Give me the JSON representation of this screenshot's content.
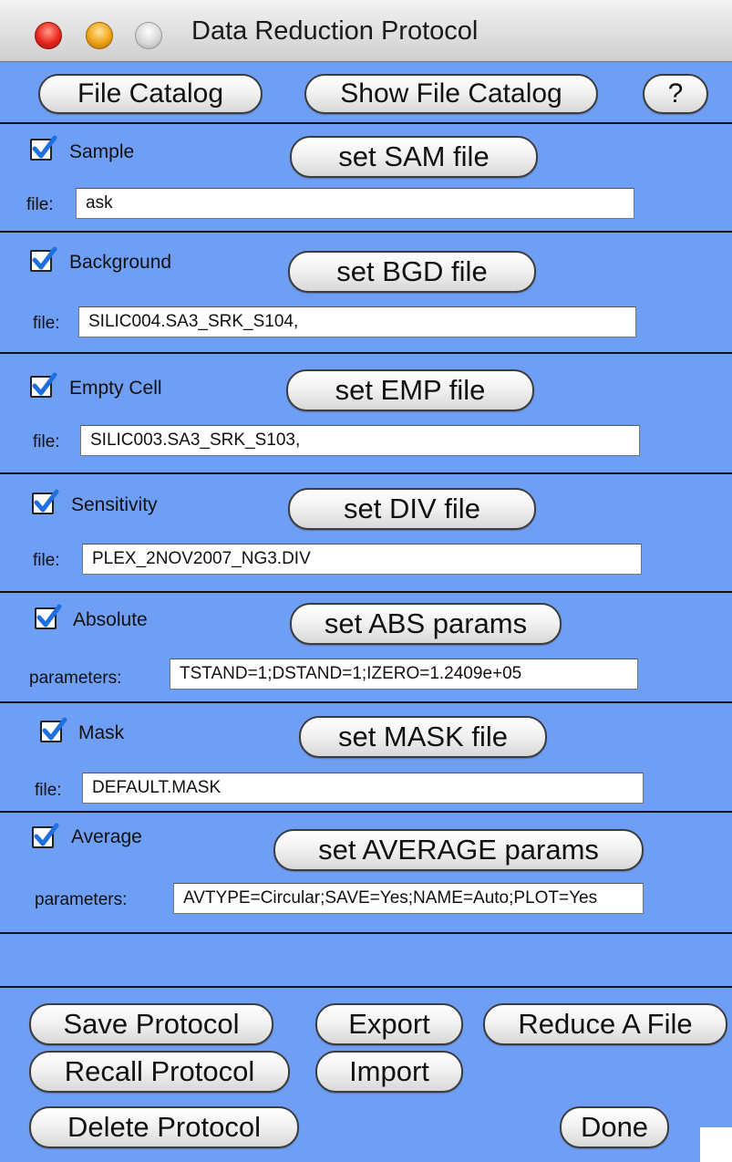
{
  "window": {
    "title": "Data Reduction Protocol"
  },
  "toolbar": {
    "file_catalog": "File Catalog",
    "show_file_catalog": "Show File Catalog",
    "help": "?"
  },
  "sections": [
    {
      "check_label": "Sample",
      "checked": true,
      "button": "set SAM file",
      "field_label": "file:",
      "value": "ask"
    },
    {
      "check_label": "Background",
      "checked": true,
      "button": "set BGD file",
      "field_label": "file:",
      "value": "SILIC004.SA3_SRK_S104,"
    },
    {
      "check_label": "Empty Cell",
      "checked": true,
      "button": "set EMP file",
      "field_label": "file:",
      "value": "SILIC003.SA3_SRK_S103,"
    },
    {
      "check_label": "Sensitivity",
      "checked": true,
      "button": "set DIV file",
      "field_label": "file:",
      "value": "PLEX_2NOV2007_NG3.DIV"
    },
    {
      "check_label": "Absolute",
      "checked": true,
      "button": "set ABS params",
      "field_label": "parameters:",
      "value": "TSTAND=1;DSTAND=1;IZERO=1.2409e+05"
    },
    {
      "check_label": "Mask",
      "checked": true,
      "button": "set MASK file",
      "field_label": "file:",
      "value": "DEFAULT.MASK"
    },
    {
      "check_label": "Average",
      "checked": true,
      "button": "set AVERAGE params",
      "field_label": "parameters:",
      "value": "AVTYPE=Circular;SAVE=Yes;NAME=Auto;PLOT=Yes"
    }
  ],
  "footer": {
    "save_protocol": "Save Protocol",
    "export": "Export",
    "reduce_a_file": "Reduce A File",
    "recall_protocol": "Recall Protocol",
    "import": "Import",
    "delete_protocol": "Delete Protocol",
    "done": "Done"
  },
  "colors": {
    "panel": "#6f9ff5",
    "separator": "#111111",
    "check": "#1f6fe0"
  }
}
